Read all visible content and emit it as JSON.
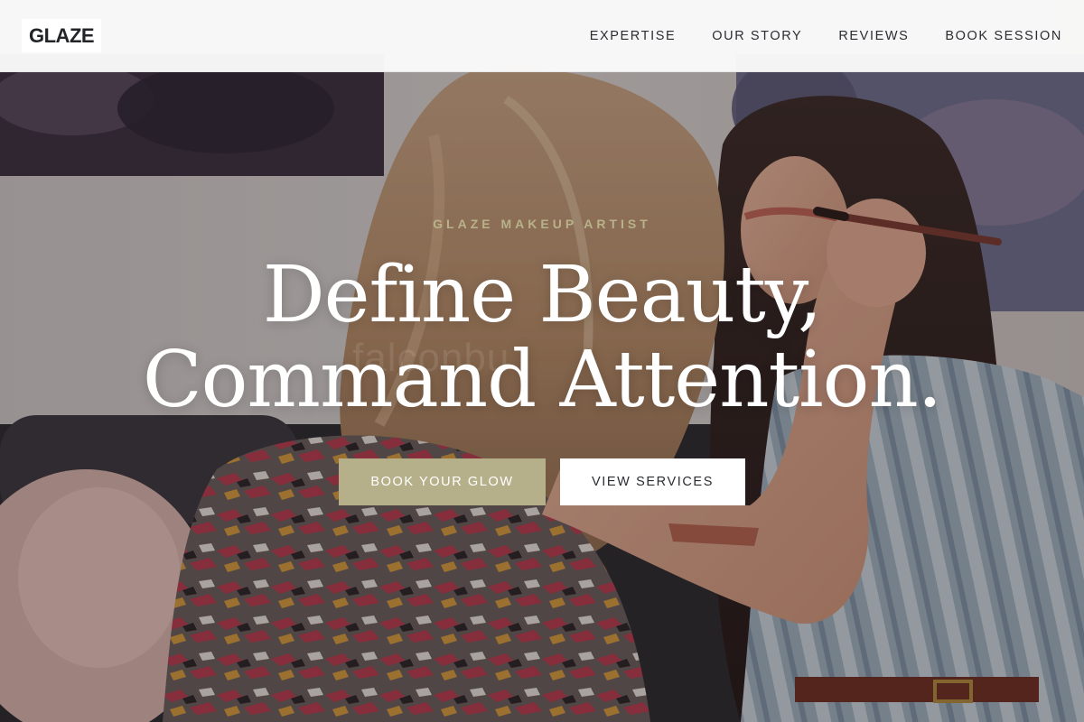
{
  "brand": {
    "logo_text": "GLAZE"
  },
  "nav": {
    "items": [
      {
        "label": "EXPERTISE"
      },
      {
        "label": "OUR STORY"
      },
      {
        "label": "REVIEWS"
      },
      {
        "label": "BOOK SESSION"
      }
    ]
  },
  "hero": {
    "eyebrow": "GLAZE MAKEUP ARTIST",
    "headline_line1": "Define Beauty,",
    "headline_line2": "Command Attention.",
    "watermark": "falconbu",
    "primary_cta": "BOOK YOUR GLOW",
    "secondary_cta": "VIEW SERVICES"
  },
  "colors": {
    "accent": "#b6b08a",
    "eyebrow": "#b8b28a",
    "header_bg": "#fafafa",
    "text_dark": "#2b2d33",
    "headline": "#ffffff"
  },
  "images": {
    "hero_background": "makeup-artist-applying-eyeshadow-photo"
  }
}
